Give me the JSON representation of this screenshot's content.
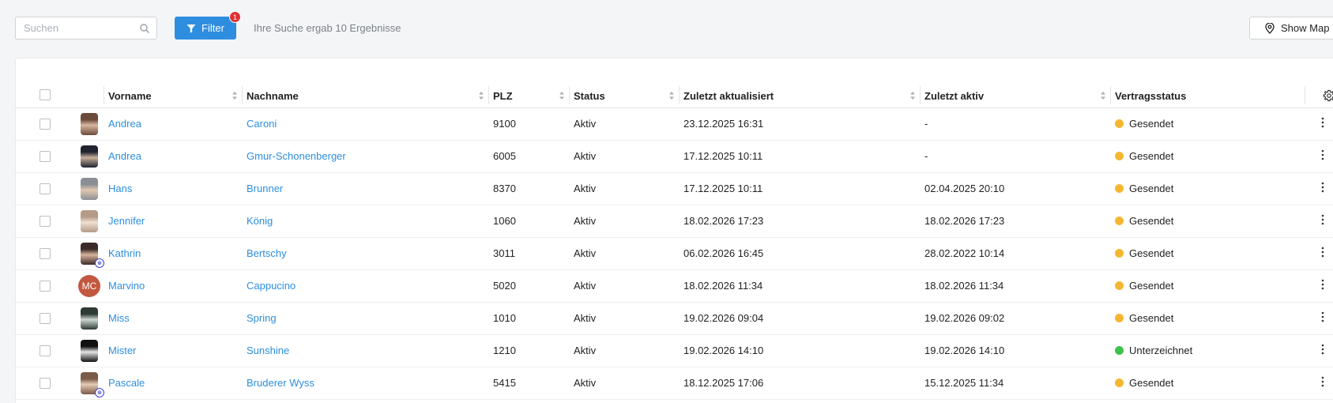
{
  "search": {
    "placeholder": "Suchen",
    "value": "",
    "icon": "search-icon"
  },
  "filter": {
    "label": "Filter",
    "badge_count": "1",
    "icon": "filter-icon"
  },
  "result_text": "Ihre Suche ergab 10 Ergebnisse",
  "map_button": {
    "label": "Show Map",
    "icon": "map-pin-icon"
  },
  "colors": {
    "accent": "#2d8ee0",
    "badge": "#e03131",
    "status_sent": "#f5b731",
    "status_signed": "#3cc24a",
    "avatar_mc": "#c2583f"
  },
  "table": {
    "headers": [
      "Vorname",
      "Nachname",
      "PLZ",
      "Status",
      "Zuletzt aktualisiert",
      "Zuletzt aktiv",
      "Vertragsstatus"
    ],
    "settings_icon": "gear-icon",
    "rows": [
      {
        "vorname": "Andrea",
        "nachname": "Caroni",
        "plz": "9100",
        "status": "Aktiv",
        "updated": "23.12.2025 16:31",
        "active": "-",
        "contract": "Gesendet",
        "contract_color": "#f5b731",
        "avatar": "photo"
      },
      {
        "vorname": "Andrea",
        "nachname": "Gmur-Schonenberger",
        "plz": "6005",
        "status": "Aktiv",
        "updated": "17.12.2025 10:11",
        "active": "-",
        "contract": "Gesendet",
        "contract_color": "#f5b731",
        "avatar": "photo"
      },
      {
        "vorname": "Hans",
        "nachname": "Brunner",
        "plz": "8370",
        "status": "Aktiv",
        "updated": "17.12.2025 10:11",
        "active": "02.04.2025 20:10",
        "contract": "Gesendet",
        "contract_color": "#f5b731",
        "avatar": "photo"
      },
      {
        "vorname": "Jennifer",
        "nachname": "König",
        "plz": "1060",
        "status": "Aktiv",
        "updated": "18.02.2026 17:23",
        "active": "18.02.2026 17:23",
        "contract": "Gesendet",
        "contract_color": "#f5b731",
        "avatar": "photo"
      },
      {
        "vorname": "Kathrin",
        "nachname": "Bertschy",
        "plz": "3011",
        "status": "Aktiv",
        "updated": "06.02.2026 16:45",
        "active": "28.02.2022 10:14",
        "contract": "Gesendet",
        "contract_color": "#f5b731",
        "avatar": "photo-badge"
      },
      {
        "vorname": "Marvino",
        "nachname": "Cappucino",
        "plz": "5020",
        "status": "Aktiv",
        "updated": "18.02.2026 11:34",
        "active": "18.02.2026 11:34",
        "contract": "Gesendet",
        "contract_color": "#f5b731",
        "avatar": "initials",
        "initials": "MC"
      },
      {
        "vorname": "Miss",
        "nachname": "Spring",
        "plz": "1010",
        "status": "Aktiv",
        "updated": "19.02.2026 09:04",
        "active": "19.02.2026 09:02",
        "contract": "Gesendet",
        "contract_color": "#f5b731",
        "avatar": "photo"
      },
      {
        "vorname": "Mister",
        "nachname": "Sunshine",
        "plz": "1210",
        "status": "Aktiv",
        "updated": "19.02.2026 14:10",
        "active": "19.02.2026 14:10",
        "contract": "Unterzeichnet",
        "contract_color": "#3cc24a",
        "avatar": "photo"
      },
      {
        "vorname": "Pascale",
        "nachname": "Bruderer Wyss",
        "plz": "5415",
        "status": "Aktiv",
        "updated": "18.12.2025 17:06",
        "active": "15.12.2025 11:34",
        "contract": "Gesendet",
        "contract_color": "#f5b731",
        "avatar": "photo-badge"
      }
    ]
  }
}
